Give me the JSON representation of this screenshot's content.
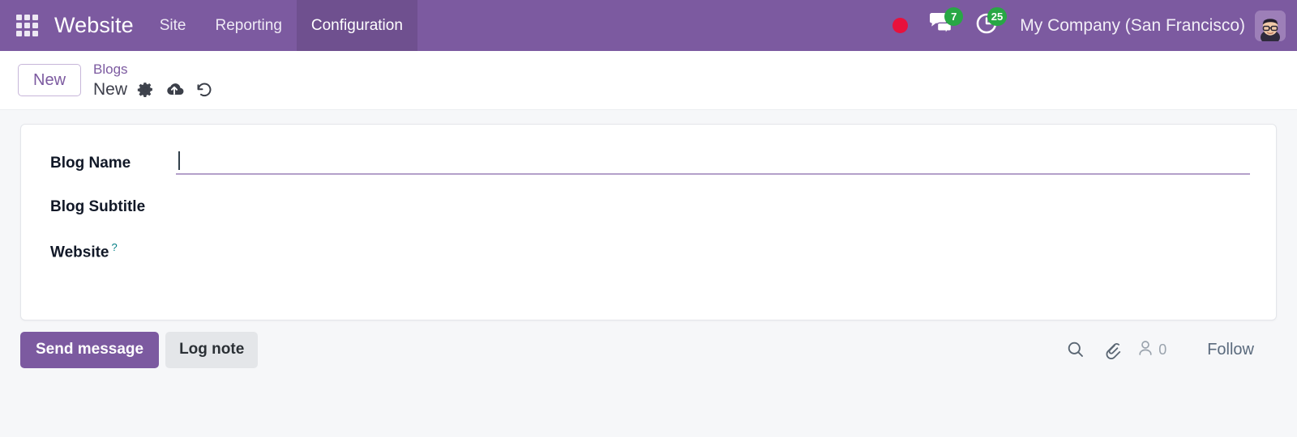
{
  "navbar": {
    "apps_icon": "apps-grid-icon",
    "brand": "Website",
    "menu_items": [
      {
        "label": "Site",
        "active": false
      },
      {
        "label": "Reporting",
        "active": false
      },
      {
        "label": "Configuration",
        "active": true
      }
    ],
    "systray": {
      "recording_indicator": "record-dot-icon",
      "messages_icon": "messages-bubble-icon",
      "messages_count": "7",
      "activities_icon": "activity-clock-icon",
      "activities_count": "25",
      "company": "My Company (San Francisco)",
      "avatar": "user-avatar"
    },
    "colors": {
      "background": "#7c5aa0",
      "active_item": "rgba(0,0,0,0.10)",
      "badge_green": "#28a745",
      "record_red": "#e8113c"
    }
  },
  "control_panel": {
    "new_button": "New",
    "breadcrumb": {
      "parent": "Blogs",
      "current": "New"
    },
    "actions": [
      {
        "name": "settings-gear-icon",
        "title": "Actions"
      },
      {
        "name": "cloud-upload-icon",
        "title": "Save manually"
      },
      {
        "name": "undo-arrow-icon",
        "title": "Discard changes"
      }
    ]
  },
  "form": {
    "fields": [
      {
        "label": "Blog Name",
        "value": "",
        "placeholder": "",
        "focused": true,
        "help": false
      },
      {
        "label": "Blog Subtitle",
        "value": "",
        "placeholder": "",
        "focused": false,
        "help": false
      },
      {
        "label": "Website",
        "value": "",
        "placeholder": "",
        "focused": false,
        "help": true,
        "help_marker": "?"
      }
    ]
  },
  "chatter": {
    "send_message": "Send message",
    "log_note": "Log note",
    "search_icon": "search-icon",
    "attachment_icon": "paperclip-icon",
    "followers_icon": "user-outline-icon",
    "followers_count": "0",
    "follow_button": "Follow"
  },
  "colors": {
    "page_background": "#f6f7f9",
    "accent_purple": "#7c5aa0",
    "input_underline": "#b4a0c9",
    "help_teal": "#017e84"
  }
}
